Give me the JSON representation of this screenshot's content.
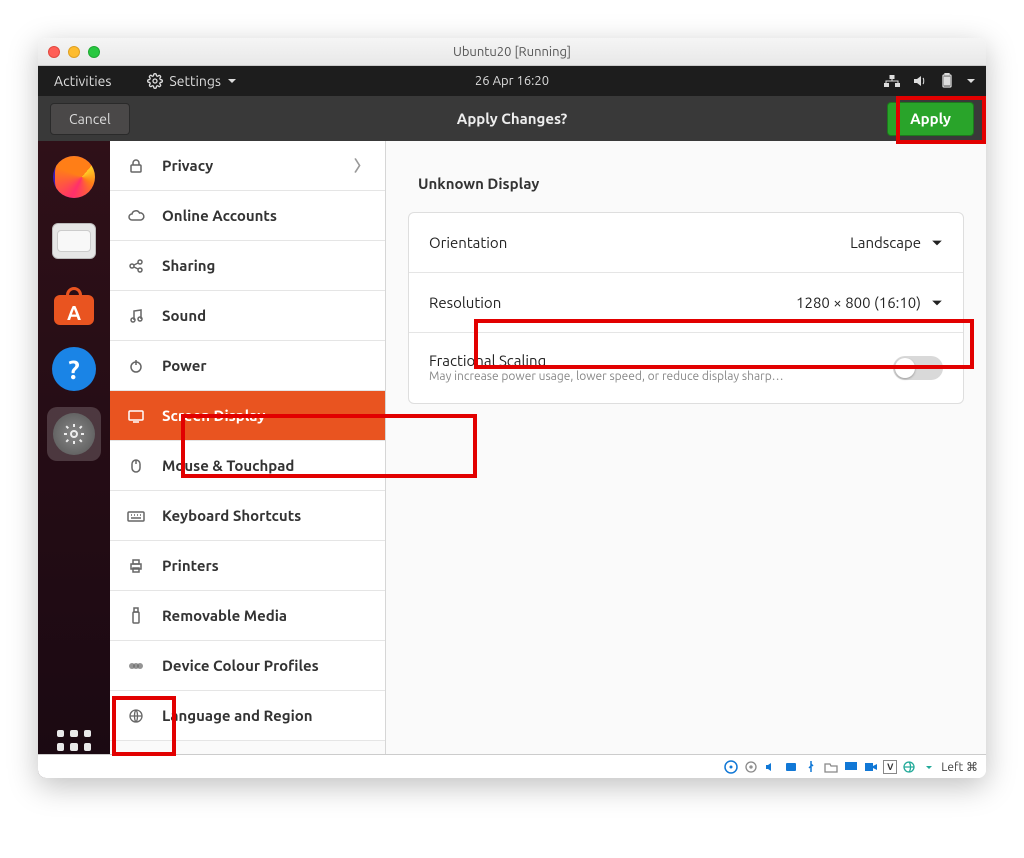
{
  "vm_window_title": "Ubuntu20 [Running]",
  "gnome": {
    "activities": "Activities",
    "app_label": "Settings",
    "datetime": "26 Apr  16:20"
  },
  "apply_bar": {
    "cancel": "Cancel",
    "title": "Apply Changes?",
    "apply": "Apply"
  },
  "sidebar": {
    "items": [
      {
        "label": "Privacy",
        "icon": "lock"
      },
      {
        "label": "Online Accounts",
        "icon": "cloud"
      },
      {
        "label": "Sharing",
        "icon": "share"
      },
      {
        "label": "Sound",
        "icon": "music"
      },
      {
        "label": "Power",
        "icon": "power"
      },
      {
        "label": "Screen Display",
        "icon": "display"
      },
      {
        "label": "Mouse & Touchpad",
        "icon": "mouse"
      },
      {
        "label": "Keyboard Shortcuts",
        "icon": "keyboard"
      },
      {
        "label": "Printers",
        "icon": "printer"
      },
      {
        "label": "Removable Media",
        "icon": "usb"
      },
      {
        "label": "Device Colour Profiles",
        "icon": "color"
      },
      {
        "label": "Language and Region",
        "icon": "globe"
      }
    ]
  },
  "main": {
    "heading": "Unknown Display",
    "orientation_label": "Orientation",
    "orientation_value": "Landscape",
    "resolution_label": "Resolution",
    "resolution_value": "1280 × 800 (16:10)",
    "fractional_label": "Fractional Scaling",
    "fractional_sub": "May increase power usage, lower speed, or reduce display sharp…"
  },
  "vm_status": {
    "right_text": "Left ⌘"
  }
}
